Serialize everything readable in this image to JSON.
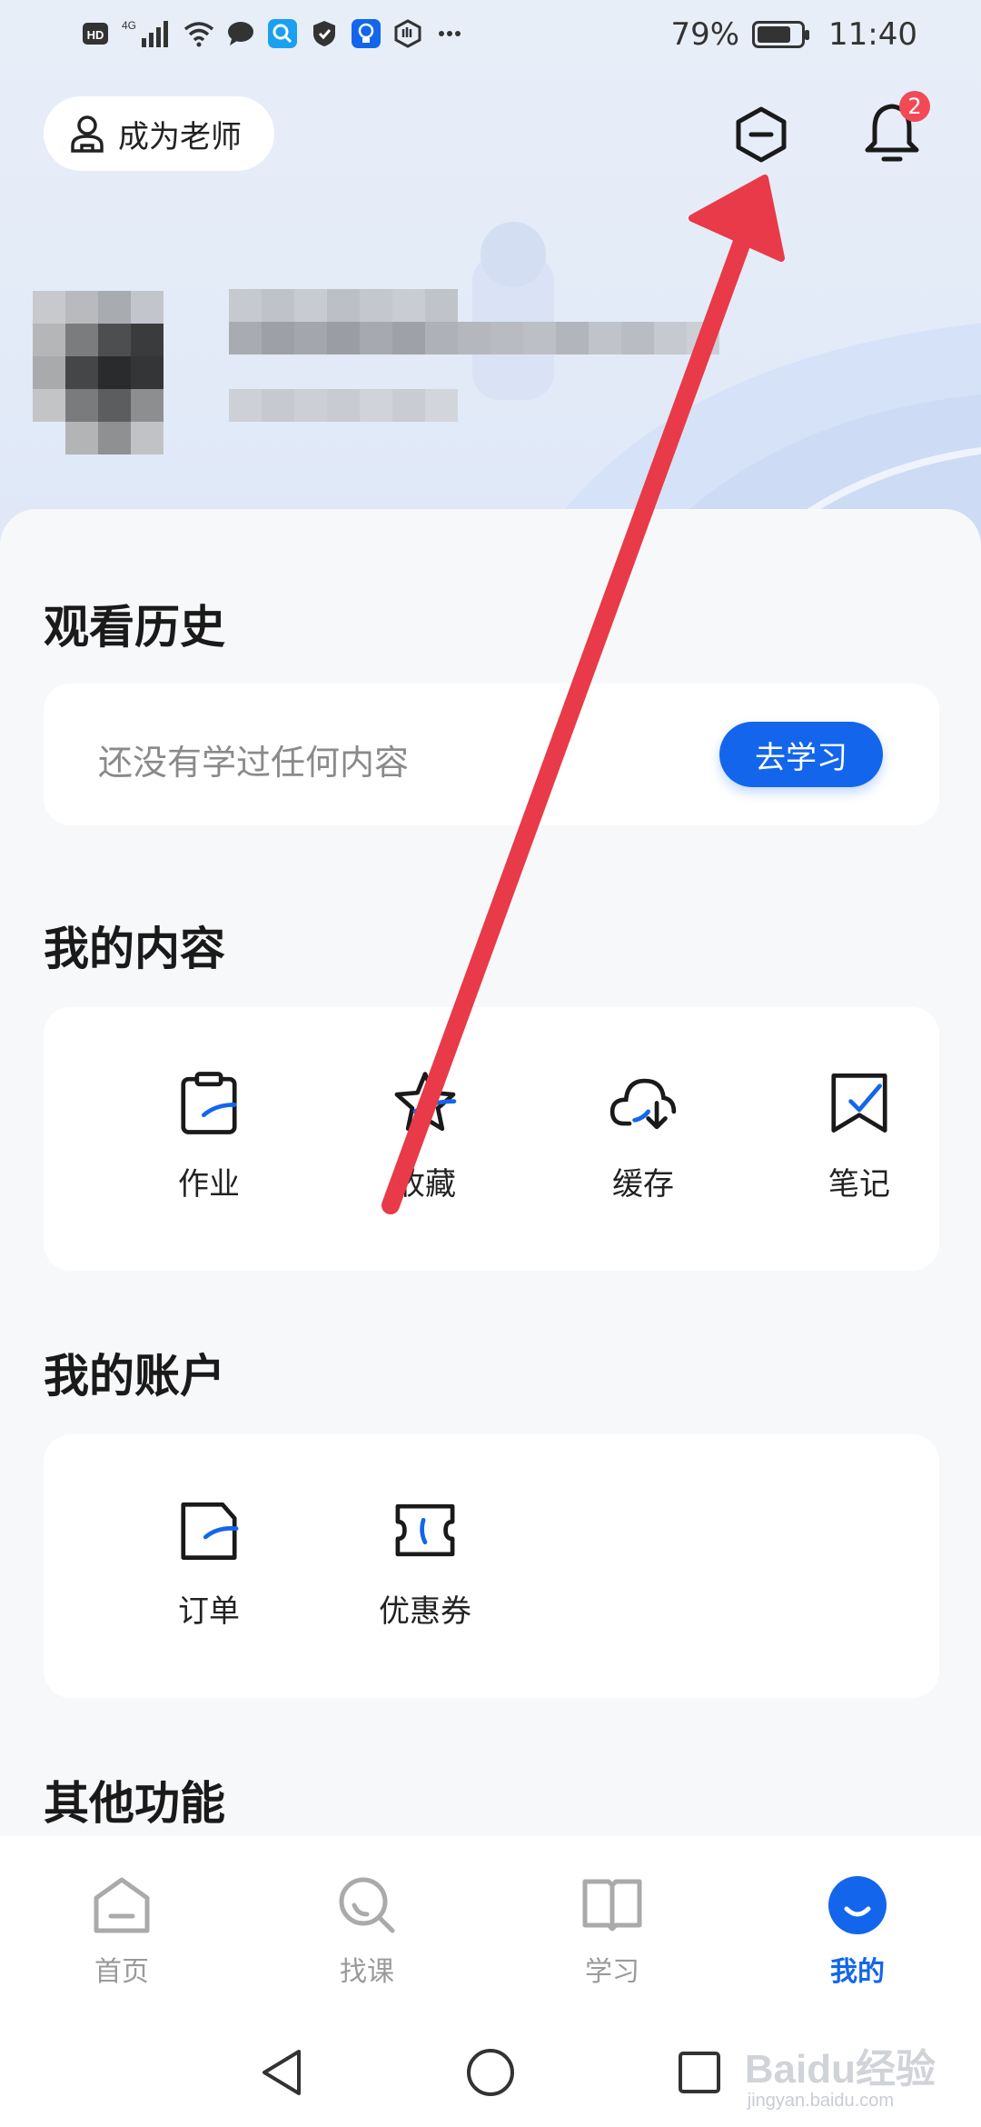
{
  "status_bar": {
    "left_labels": [
      "HD",
      "4G"
    ],
    "battery": "79%",
    "time": "11:40"
  },
  "header": {
    "teacher_label": "成为老师",
    "notification_count": "2"
  },
  "history": {
    "title": "观看历史",
    "empty_text": "还没有学过任何内容",
    "button": "去学习"
  },
  "my_content": {
    "title": "我的内容",
    "items": [
      {
        "label": "作业",
        "icon": "homework-icon"
      },
      {
        "label": "收藏",
        "icon": "favorite-icon"
      },
      {
        "label": "缓存",
        "icon": "cache-icon"
      },
      {
        "label": "笔记",
        "icon": "note-icon"
      }
    ]
  },
  "my_account": {
    "title": "我的账户",
    "items": [
      {
        "label": "订单",
        "icon": "order-icon"
      },
      {
        "label": "优惠券",
        "icon": "coupon-icon"
      }
    ]
  },
  "other": {
    "title": "其他功能"
  },
  "bottom_nav": {
    "items": [
      {
        "label": "首页"
      },
      {
        "label": "找课"
      },
      {
        "label": "学习"
      },
      {
        "label": "我的"
      }
    ],
    "active": "我的"
  },
  "watermark": {
    "main": "Baidu经验",
    "sub": "jingyan.baidu.com"
  },
  "colors": {
    "accent": "#1366ec",
    "badge": "#f24957",
    "arrow": "#e83a48"
  }
}
